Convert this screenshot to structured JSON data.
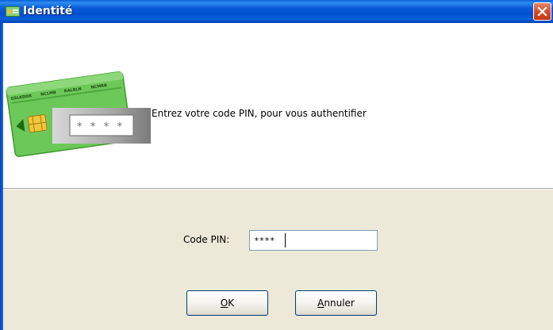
{
  "window": {
    "title": "Identité",
    "close_icon": "close-icon"
  },
  "header": {
    "instruction": "Entrez votre code PIN, pour vous authentifier",
    "card": {
      "labels": [
        "GSLKDDR",
        "NCLMB",
        "RALRLN",
        "NCMRB"
      ],
      "pin_mask": "* * * *"
    }
  },
  "form": {
    "pin_label": "Code PIN:",
    "pin_value": "****"
  },
  "buttons": {
    "ok_mnemonic": "O",
    "ok_rest": "K",
    "cancel_mnemonic": "A",
    "cancel_rest": "nnuler"
  },
  "colors": {
    "title_bar": "#0a5fd8",
    "panel_background": "#ece9d8",
    "card_green": "#6dc85a"
  }
}
